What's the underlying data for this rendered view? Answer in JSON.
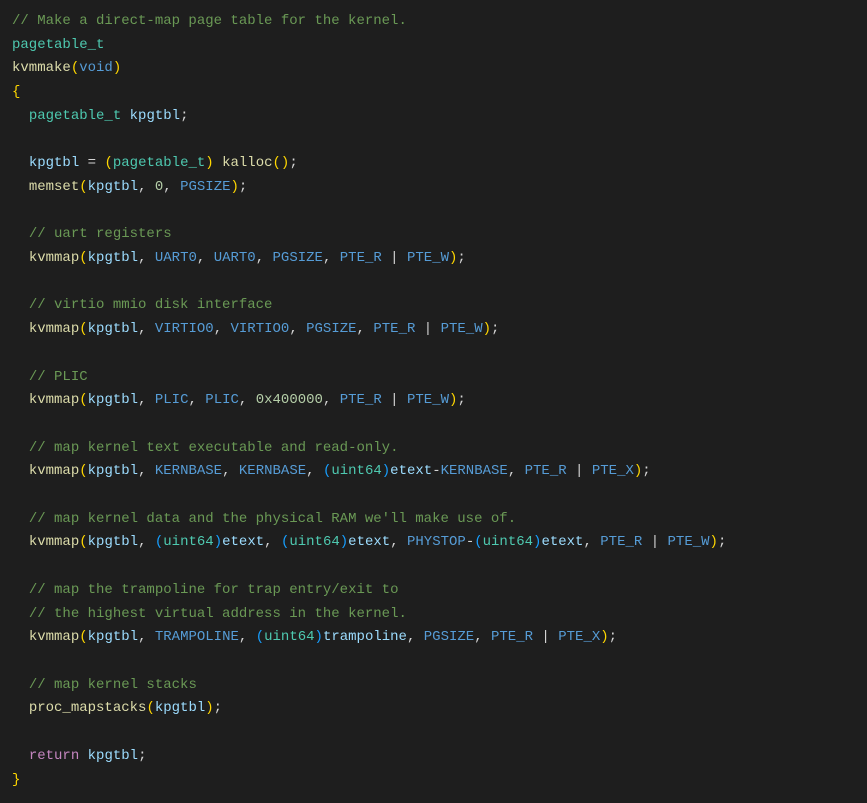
{
  "lines": {
    "c1": "// Make a direct-map page table for the kernel.",
    "c2": "// uart registers",
    "c3": "// virtio mmio disk interface",
    "c4": "// PLIC",
    "c5": "// map kernel text executable and read-only.",
    "c6": "// map kernel data and the physical RAM we'll make use of.",
    "c7": "// map the trampoline for trap entry/exit to",
    "c8": "// the highest virtual address in the kernel.",
    "c9": "// map kernel stacks"
  },
  "types": {
    "pagetable_t": "pagetable_t",
    "void": "void",
    "uint64": "uint64"
  },
  "funcs": {
    "kvmmake": "kvmmake",
    "kalloc": "kalloc",
    "memset": "memset",
    "kvmmap": "kvmmap",
    "proc_mapstacks": "proc_mapstacks"
  },
  "ids": {
    "kpgtbl": "kpgtbl",
    "etext": "etext",
    "trampoline": "trampoline"
  },
  "macros": {
    "PGSIZE": "PGSIZE",
    "UART0": "UART0",
    "PTE_R": "PTE_R",
    "PTE_W": "PTE_W",
    "VIRTIO0": "VIRTIO0",
    "PLIC": "PLIC",
    "KERNBASE": "KERNBASE",
    "PTE_X": "PTE_X",
    "PHYSTOP": "PHYSTOP",
    "TRAMPOLINE": "TRAMPOLINE"
  },
  "nums": {
    "zero": "0",
    "plic_size": "0x400000"
  },
  "kw": {
    "return": "return"
  },
  "sym": {
    "open_brace": "{",
    "close_brace": "}",
    "open_paren": "(",
    "close_paren": ")",
    "semicolon": ";",
    "comma": ", ",
    "eq": " = ",
    "pipe": " | ",
    "minus": "-",
    "space": " "
  }
}
